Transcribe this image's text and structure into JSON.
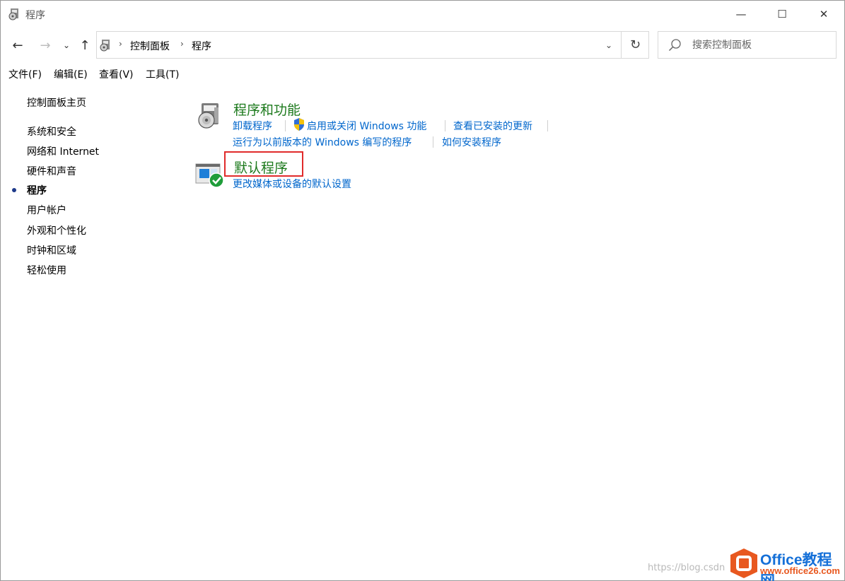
{
  "window": {
    "title": "程序",
    "buttons": {
      "minimize": "—",
      "maximize": "☐",
      "close": "✕"
    }
  },
  "nav": {
    "back": "←",
    "forward": "→",
    "recent": "⌄",
    "up": "↑"
  },
  "address": {
    "crumb_sep": "›",
    "crumbs": [
      "控制面板",
      "程序"
    ],
    "dropdown": "⌄",
    "refresh": "↻"
  },
  "search": {
    "placeholder": "搜索控制面板"
  },
  "menu": [
    {
      "label": "文件(F)"
    },
    {
      "label": "编辑(E)"
    },
    {
      "label": "查看(V)"
    },
    {
      "label": "工具(T)"
    }
  ],
  "sidebar": {
    "home": "控制面板主页",
    "items": [
      {
        "label": "系统和安全"
      },
      {
        "label": "网络和 Internet"
      },
      {
        "label": "硬件和声音"
      },
      {
        "label": "程序",
        "active": true
      },
      {
        "label": "用户帐户"
      },
      {
        "label": "外观和个性化"
      },
      {
        "label": "时钟和区域"
      },
      {
        "label": "轻松使用"
      }
    ]
  },
  "categories": [
    {
      "title": "程序和功能",
      "icon": "programs-features-icon",
      "links": [
        "卸载程序",
        "启用或关闭 Windows 功能",
        "查看已安装的更新",
        "运行为以前版本的 Windows 编写的程序",
        "如何安装程序"
      ]
    },
    {
      "title": "默认程序",
      "icon": "default-programs-icon",
      "links": [
        "更改媒体或设备的默认设置"
      ]
    }
  ],
  "watermark": {
    "url": "https://blog.csdn",
    "brand": "Office教程网",
    "site": "www.office26.com"
  },
  "colors": {
    "category_title": "#1d7a1d",
    "link": "#0066cc",
    "highlight": "#e02b2b"
  }
}
